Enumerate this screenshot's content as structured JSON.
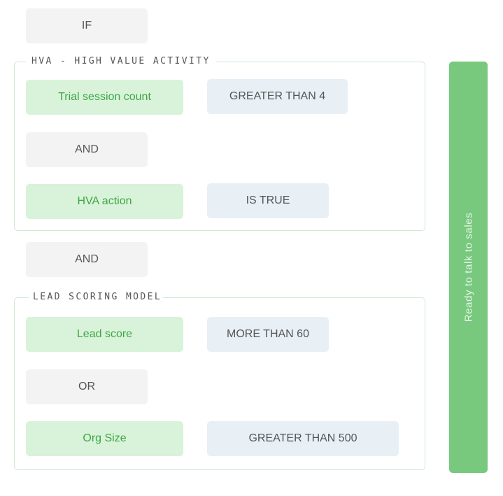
{
  "flow": {
    "start_operator": "IF",
    "groups": [
      {
        "title": "HVA - HIGH VALUE ACTIVITY",
        "rules": [
          {
            "field": "Trial session count",
            "condition": "GREATER THAN 4"
          },
          {
            "field": "HVA action",
            "condition": "IS TRUE"
          }
        ],
        "operator": "AND"
      },
      {
        "title": "LEAD SCORING MODEL",
        "rules": [
          {
            "field": "Lead score",
            "condition": "MORE THAN 60"
          },
          {
            "field": "Org Size",
            "condition": "GREATER THAN 500"
          }
        ],
        "operator": "OR"
      }
    ],
    "between_groups_operator": "AND",
    "result": "Ready to talk to sales"
  },
  "colors": {
    "field_bg": "#d8f3d9",
    "field_text": "#3fa546",
    "condition_bg": "#e8f0f6",
    "operator_bg": "#f3f3f3",
    "result_bg": "#78c87e",
    "group_border": "#cfe9d3"
  }
}
